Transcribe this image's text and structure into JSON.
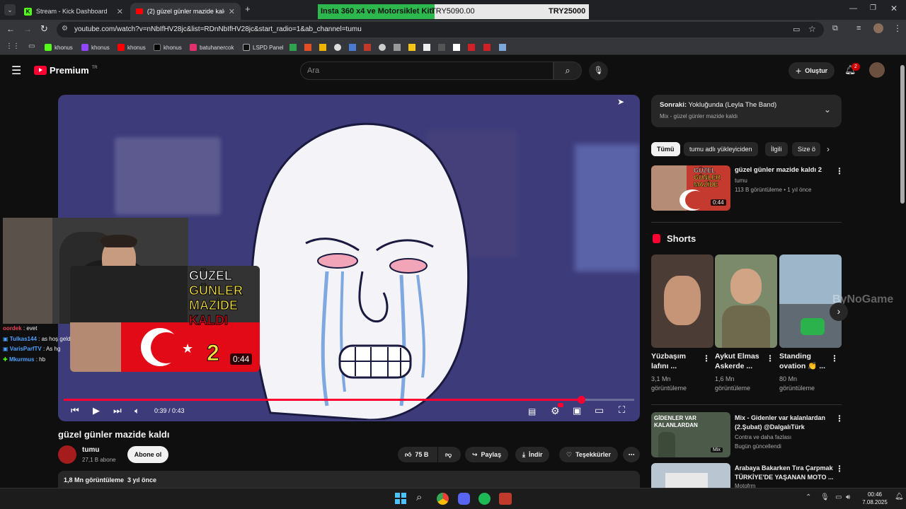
{
  "browser": {
    "tabs": [
      {
        "title": "Stream - Kick Dashboard",
        "active": false
      },
      {
        "title": "(2) güzel günler mazide kaldı -",
        "active": true
      }
    ],
    "ad_banner": {
      "text": "Insta 360 x4 ve Motorsiklet Kiti",
      "price1": "TRY5090.00",
      "price2": "TRY25000"
    },
    "url": "youtube.com/watch?v=nNbIfHV28jc&list=RDnNbIfHV28jc&start_radio=1&ab_channel=tumu",
    "bookmarks": [
      "khonus",
      "khonus",
      "khonus",
      "khonus",
      "batuhanercok",
      "LSPD Panel"
    ]
  },
  "youtube": {
    "logo": "Premium",
    "logo_region": "TR",
    "search_placeholder": "Ara",
    "create_label": "Oluştur",
    "notif_count": "2",
    "video": {
      "title": "güzel günler mazide kaldı",
      "time": "0:39 / 0:43",
      "progress": 0.907,
      "channel": "tumu",
      "subs": "27,1 B abone",
      "subscribe": "Abone ol",
      "likes": "75 B",
      "share": "Paylaş",
      "download": "İndir",
      "thanks": "Teşekkürler",
      "views_line": "1,8 Mn görüntüleme  3 yıl önce"
    },
    "overlay_thumb": {
      "text1": "GÜZEL",
      "text2": "GÜNLER",
      "text3": "MAZİDE",
      "text4": "KALDI",
      "num": "2",
      "duration": "0:44"
    },
    "watermark": "ByNoGame",
    "next": {
      "label": "Sonraki:",
      "title": "Yokluğunda (Leyla The Band)",
      "sub": "Mix - güzel günler mazide kaldı"
    },
    "chips": [
      "Tümü",
      "tumu adlı yükleyiciden",
      "İlgili",
      "Size ö"
    ],
    "rec1": {
      "title": "güzel günler mazide kaldı 2",
      "channel": "tumu",
      "meta": "113 B görüntüleme • 1 yıl önce",
      "duration": "0:44"
    },
    "shorts_header": "Shorts",
    "shorts": [
      {
        "title1": "Yüzbaşım",
        "title2": "lafını ...",
        "views1": "3,1 Mn",
        "views2": "görüntüleme"
      },
      {
        "title1": "Aykut Elmas",
        "title2": "Askerde ...",
        "views1": "1,6 Mn",
        "views2": "görüntüleme"
      },
      {
        "title1": "Standing",
        "title2": "ovation 👏 ...",
        "views1": "80 Mn",
        "views2": "görüntüleme"
      }
    ],
    "rec2": {
      "title1": "Mix - Gidenler var kalanlardan",
      "title2": "(2.Şubat) @DalgalıTürk",
      "channel": "Contra ve daha fazlası",
      "meta": "Bugün güncellendi",
      "badge": "Mix",
      "thumb1": "GİDENLER VAR",
      "thumb2": "KALANLARDAN"
    },
    "rec3": {
      "title1": "Arabaya Bakarken Tıra Çarpmak",
      "title2": "TÜRKİYE'DE YAŞANAN MOTO ...",
      "channel": "Motofrm"
    }
  },
  "stream_chat": [
    {
      "user": "oordek",
      "msg": "evet",
      "color": "#e9465b"
    },
    {
      "user": "Tulkas144",
      "msg": "as hoş geldin",
      "color": "#4ea1ff"
    },
    {
      "user": "VarisParfTV",
      "msg": "As hg",
      "color": "#4ea1ff"
    },
    {
      "user": "Mkurmus",
      "msg": "hb",
      "color": "#4ea1ff"
    }
  ],
  "taskbar": {
    "time": "00:46",
    "date": "7.08.2025"
  }
}
